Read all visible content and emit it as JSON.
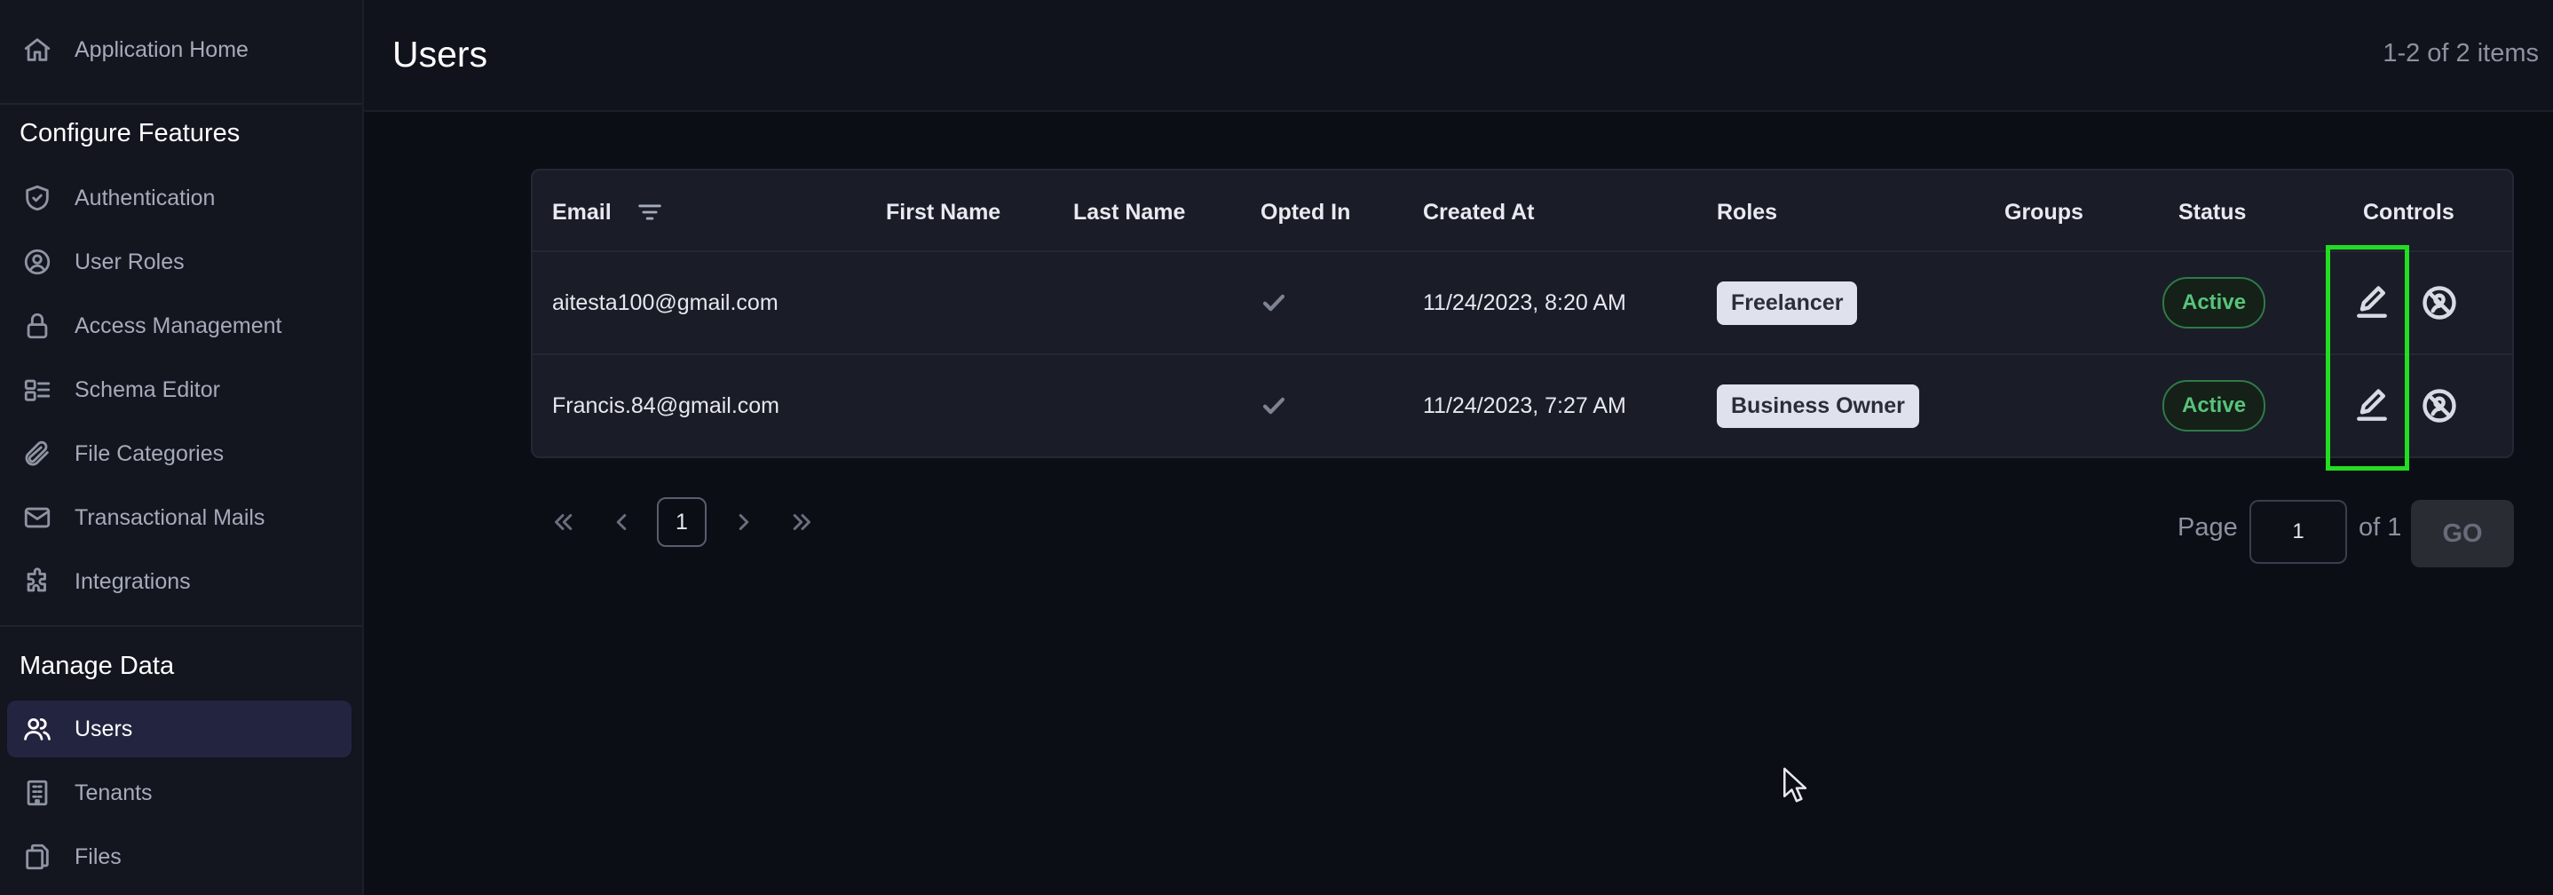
{
  "sidebar": {
    "top_item": {
      "label": "Application Home",
      "icon": "home-icon"
    },
    "sections": [
      {
        "title": "Configure Features",
        "items": [
          {
            "label": "Authentication",
            "icon": "shield-check-icon"
          },
          {
            "label": "User Roles",
            "icon": "user-circle-icon"
          },
          {
            "label": "Access Management",
            "icon": "lock-icon"
          },
          {
            "label": "Schema Editor",
            "icon": "schema-icon"
          },
          {
            "label": "File Categories",
            "icon": "paperclip-icon"
          },
          {
            "label": "Transactional Mails",
            "icon": "mail-icon"
          },
          {
            "label": "Integrations",
            "icon": "puzzle-icon"
          }
        ]
      },
      {
        "title": "Manage Data",
        "items": [
          {
            "label": "Users",
            "icon": "users-icon",
            "active": true
          },
          {
            "label": "Tenants",
            "icon": "building-icon"
          },
          {
            "label": "Files",
            "icon": "files-icon"
          }
        ]
      }
    ]
  },
  "header": {
    "title": "Users",
    "item_count": "1-2 of 2 items"
  },
  "table": {
    "columns": [
      "Email",
      "First Name",
      "Last Name",
      "Opted In",
      "Created At",
      "Roles",
      "Groups",
      "Status",
      "Controls"
    ],
    "rows": [
      {
        "email": "aitesta100@gmail.com",
        "first_name": "",
        "last_name": "",
        "opted_in": true,
        "created_at": "11/24/2023, 8:20 AM",
        "role": "Freelancer",
        "groups": "",
        "status": "Active"
      },
      {
        "email": "Francis.84@gmail.com",
        "first_name": "",
        "last_name": "",
        "opted_in": true,
        "created_at": "11/24/2023, 7:27 AM",
        "role": "Business Owner",
        "groups": "",
        "status": "Active"
      }
    ]
  },
  "pagination": {
    "current_page": "1",
    "page_label": "Page",
    "page_input_value": "1",
    "of_label": "of 1",
    "go_label": "GO"
  },
  "colors": {
    "accent_active_bg": "#232440",
    "status_active": "#58c37a",
    "highlight": "#22dd22"
  }
}
